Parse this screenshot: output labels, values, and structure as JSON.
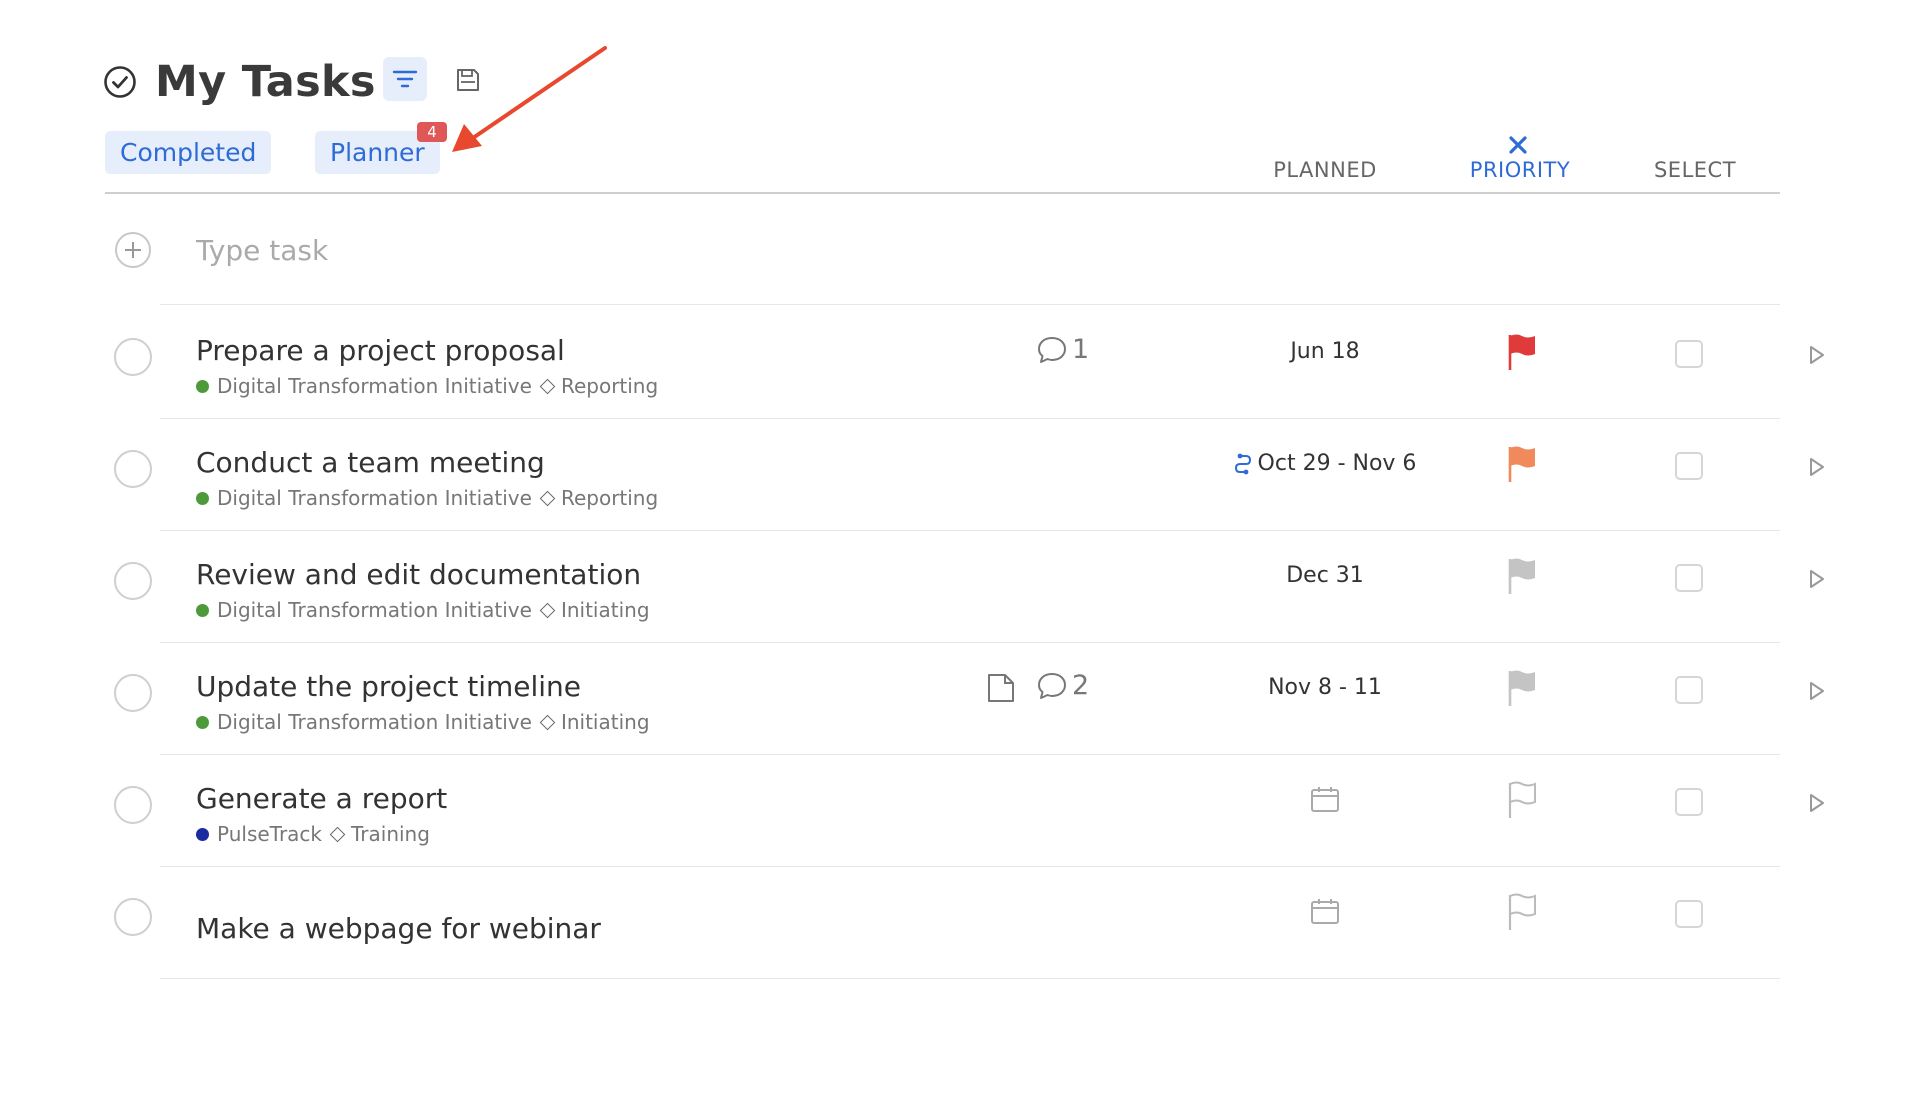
{
  "header": {
    "title": "My Tasks",
    "icons": {
      "title": "check-circle-icon",
      "filter": "filter-lines-icon",
      "save": "save-icon"
    }
  },
  "chips": {
    "completed": "Completed",
    "planner": "Planner",
    "planner_badge": "4"
  },
  "columns": {
    "planned": "PLANNED",
    "priority": "PRIORITY",
    "select": "SELECT"
  },
  "add_task": {
    "placeholder": "Type task"
  },
  "colors": {
    "accent": "#2e6bd6",
    "chip_bg": "#e6eefb",
    "badge": "#e05757",
    "flag_red": "#e03a3a",
    "flag_orange": "#f08a5d",
    "flag_gray": "#c4c4c4",
    "project_green": "#4e9a3a",
    "project_navy": "#1a2aa0"
  },
  "tasks": [
    {
      "title": "Prepare a project proposal",
      "project": "Digital Transformation Initiative",
      "project_color": "#4e9a3a",
      "phase": "Reporting",
      "comments": "1",
      "has_note": false,
      "planned": "Jun 18",
      "recurring": false,
      "priority": "red"
    },
    {
      "title": "Conduct a team meeting",
      "project": "Digital Transformation Initiative",
      "project_color": "#4e9a3a",
      "phase": "Reporting",
      "comments": "",
      "has_note": false,
      "planned": "Oct 29 - Nov 6",
      "recurring": true,
      "priority": "orange"
    },
    {
      "title": "Review and edit documentation",
      "project": "Digital Transformation Initiative",
      "project_color": "#4e9a3a",
      "phase": "Initiating",
      "comments": "",
      "has_note": false,
      "planned": "Dec 31",
      "recurring": false,
      "priority": "gray"
    },
    {
      "title": "Update the project timeline",
      "project": "Digital Transformation Initiative",
      "project_color": "#4e9a3a",
      "phase": "Initiating",
      "comments": "2",
      "has_note": true,
      "planned": "Nov 8 - 11",
      "recurring": false,
      "priority": "gray"
    },
    {
      "title": "Generate a report",
      "project": "PulseTrack",
      "project_color": "#1a2aa0",
      "phase": "Training",
      "comments": "",
      "has_note": false,
      "planned": "",
      "recurring": false,
      "priority": "none"
    },
    {
      "title": "Make a webpage for webinar",
      "project": "",
      "project_color": "",
      "phase": "",
      "comments": "",
      "has_note": false,
      "planned": "",
      "recurring": false,
      "priority": "none",
      "no_open": true
    }
  ]
}
